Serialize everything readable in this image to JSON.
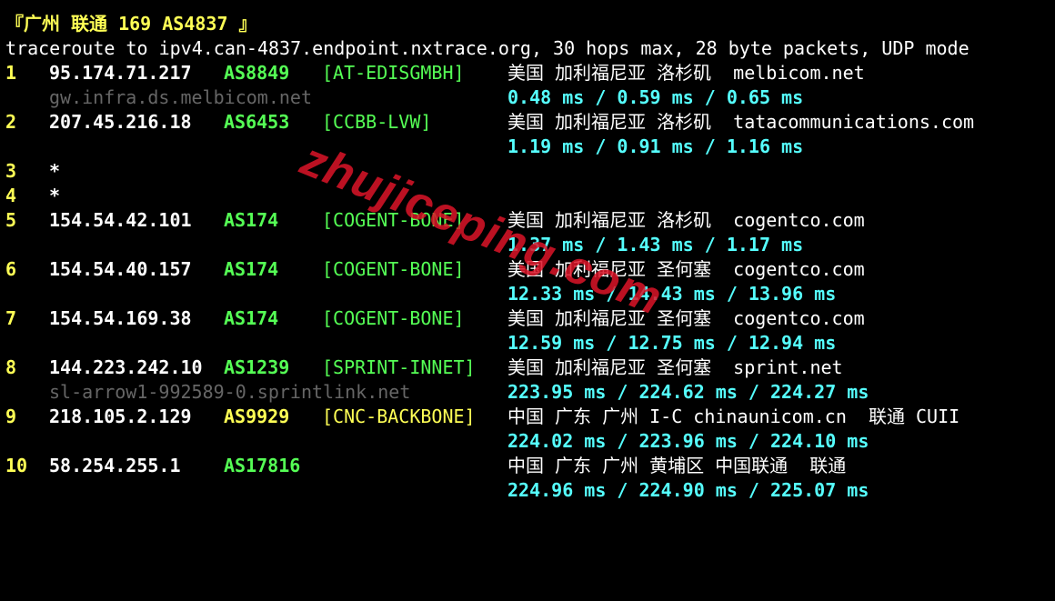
{
  "title_line": "『广州 联通 169 AS4837 』",
  "command": "traceroute to ipv4.can-4837.endpoint.nxtrace.org, 30 hops max, 28 byte packets, UDP mode",
  "hops": [
    {
      "num": "1",
      "ip": "95.174.71.217",
      "asn": "AS8849",
      "asname": "[AT-EDISGMBH]",
      "geo": "美国 加利福尼亚 洛杉矶  melbicom.net",
      "ptr": "gw.infra.ds.melbicom.net",
      "rtt": "0.48 ms / 0.59 ms / 0.65 ms"
    },
    {
      "num": "2",
      "ip": "207.45.216.18",
      "asn": "AS6453",
      "asname": "[CCBB-LVW]",
      "geo": "美国 加利福尼亚 洛杉矶  tatacommunications.com",
      "ptr": "",
      "rtt": "1.19 ms / 0.91 ms / 1.16 ms"
    },
    {
      "num": "3",
      "star": "*"
    },
    {
      "num": "4",
      "star": "*"
    },
    {
      "num": "5",
      "ip": "154.54.42.101",
      "asn": "AS174",
      "asname": "[COGENT-BONE]",
      "geo": "美国 加利福尼亚 洛杉矶  cogentco.com",
      "ptr": "",
      "rtt": "1.37 ms / 1.43 ms / 1.17 ms"
    },
    {
      "num": "6",
      "ip": "154.54.40.157",
      "asn": "AS174",
      "asname": "[COGENT-BONE]",
      "geo": "美国 加利福尼亚 圣何塞  cogentco.com",
      "ptr": "",
      "rtt": "12.33 ms / 14.43 ms / 13.96 ms"
    },
    {
      "num": "7",
      "ip": "154.54.169.38",
      "asn": "AS174",
      "asname": "[COGENT-BONE]",
      "geo": "美国 加利福尼亚 圣何塞  cogentco.com",
      "ptr": "",
      "rtt": "12.59 ms / 12.75 ms / 12.94 ms"
    },
    {
      "num": "8",
      "ip": "144.223.242.10",
      "asn": "AS1239",
      "asname": "[SPRINT-INNET]",
      "geo": "美国 加利福尼亚 圣何塞  sprint.net",
      "ptr": "sl-arrow1-992589-0.sprintlink.net",
      "rtt": "223.95 ms / 224.62 ms / 224.27 ms"
    },
    {
      "num": "9",
      "ip": "218.105.2.129",
      "asn": "AS9929",
      "asname": "[CNC-BACKBONE]",
      "geo": "中国 广东 广州 I-C chinaunicom.cn  联通 CUII",
      "ptr": "",
      "rtt": "224.02 ms / 223.96 ms / 224.10 ms"
    },
    {
      "num": "10",
      "ip": "58.254.255.1",
      "asn": "AS17816",
      "asname": "",
      "geo": "中国 广东 广州 黄埔区 中国联通  联通",
      "ptr": "",
      "rtt": "224.96 ms / 224.90 ms / 225.07 ms"
    }
  ],
  "watermark": "zhujiceping.com"
}
